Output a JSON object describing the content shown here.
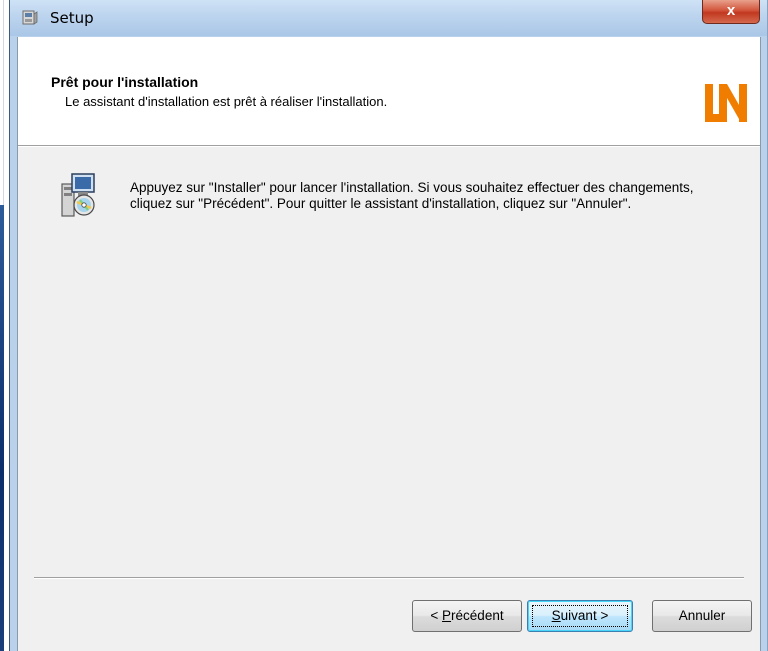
{
  "window": {
    "title": "Setup",
    "close_label": "x"
  },
  "header": {
    "title": "Prêt pour l'installation",
    "subtitle": "Le assistant d'installation est prêt à réaliser l'installation.",
    "logo_text": "LN"
  },
  "body": {
    "message": "Appuyez sur \"Installer\" pour lancer l'installation. Si vous souhaitez effectuer des changements, cliquez sur \"Précédent\". Pour quitter le assistant d'installation, cliquez sur \"Annuler\"."
  },
  "buttons": {
    "prev_prefix": "< ",
    "prev_mnemonic": "P",
    "prev_rest": "récédent",
    "next_mnemonic": "S",
    "next_rest": "uivant >",
    "cancel": "Annuler"
  },
  "colors": {
    "logo_orange": "#f07d00",
    "title_bar": "#bcd4ee",
    "close_red": "#c1381f"
  }
}
